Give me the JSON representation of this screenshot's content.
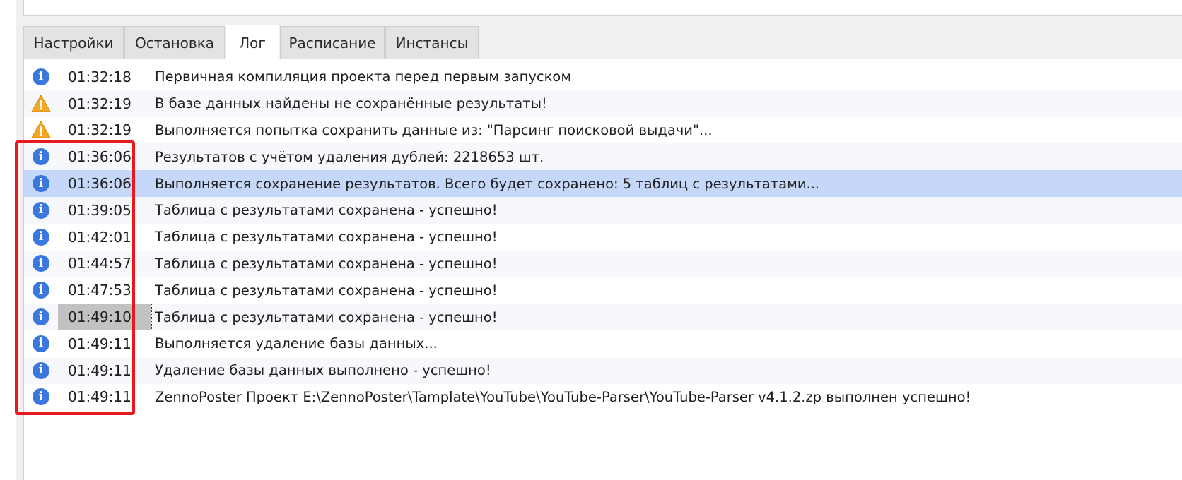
{
  "tabs": [
    {
      "label": "Настройки"
    },
    {
      "label": "Остановка"
    },
    {
      "label": "Лог",
      "active": true
    },
    {
      "label": "Расписание"
    },
    {
      "label": "Инстансы"
    }
  ],
  "colors": {
    "info": "#3a78e0",
    "warning": "#f5a623",
    "selection": "#c6d8f9",
    "highlight": "#e8181f"
  },
  "log": [
    {
      "icon": "info-icon",
      "time": "01:32:18",
      "message": "Первичная компиляция проекта перед первым запуском"
    },
    {
      "icon": "warning-icon",
      "time": "01:32:19",
      "message": "В базе данных найдены не сохранённые результаты!"
    },
    {
      "icon": "warning-icon",
      "time": "01:32:19",
      "message": "Выполняется попытка сохранить данные из: \"Парсинг поисковой выдачи\"..."
    },
    {
      "icon": "info-icon",
      "time": "01:36:06",
      "message": "Результатов с учётом удаления дублей: 2218653 шт."
    },
    {
      "icon": "info-icon",
      "time": "01:36:06",
      "message": "Выполняется сохранение результатов. Всего будет сохранено: 5 таблиц с результатами..."
    },
    {
      "icon": "info-icon",
      "time": "01:39:05",
      "message": "Таблица с результатами сохранена - успешно!"
    },
    {
      "icon": "info-icon",
      "time": "01:42:01",
      "message": "Таблица с результатами сохранена - успешно!"
    },
    {
      "icon": "info-icon",
      "time": "01:44:57",
      "message": "Таблица с результатами сохранена - успешно!"
    },
    {
      "icon": "info-icon",
      "time": "01:47:53",
      "message": "Таблица с результатами сохранена - успешно!"
    },
    {
      "icon": "info-icon",
      "time": "01:49:10",
      "message": "Таблица с результатами сохранена - успешно!"
    },
    {
      "icon": "info-icon",
      "time": "01:49:11",
      "message": "Выполняется удаление базы данных..."
    },
    {
      "icon": "info-icon",
      "time": "01:49:11",
      "message": "Удаление базы данных выполнено - успешно!"
    },
    {
      "icon": "info-icon",
      "time": "01:49:11",
      "message": "ZennoPoster Проект E:\\ZennoPoster\\Tamplate\\YouTube\\YouTube-Parser\\YouTube-Parser v4.1.2.zp выполнен успешно!"
    }
  ]
}
